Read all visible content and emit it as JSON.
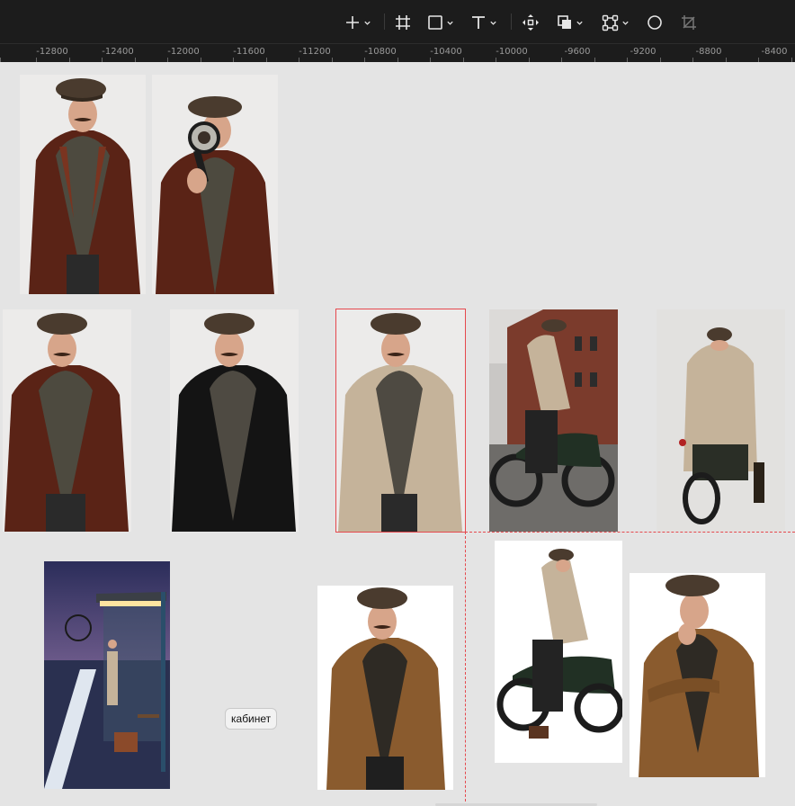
{
  "toolbar": {
    "tools": [
      {
        "name": "add",
        "icon": "plus-icon",
        "has_menu": true
      },
      {
        "name": "frame",
        "icon": "frame-icon",
        "has_menu": false
      },
      {
        "name": "shape",
        "icon": "rectangle-icon",
        "has_menu": true
      },
      {
        "name": "text",
        "icon": "text-icon",
        "has_menu": true
      },
      {
        "name": "move",
        "icon": "move-icon",
        "has_menu": false
      },
      {
        "name": "boolean",
        "icon": "boolean-icon",
        "has_menu": true
      },
      {
        "name": "component",
        "icon": "component-icon",
        "has_menu": true
      },
      {
        "name": "ellipse",
        "icon": "circle-icon",
        "has_menu": false
      },
      {
        "name": "crop",
        "icon": "crop-icon",
        "has_menu": false
      }
    ]
  },
  "ruler": {
    "labels": [
      "-12800",
      "-12400",
      "-12000",
      "-11600",
      "-11200",
      "-10800",
      "-10400",
      "-10000",
      "-9600",
      "-9200",
      "-8800",
      "-8400"
    ]
  },
  "canvas": {
    "sticky_note": "кабинет",
    "images": [
      {
        "id": "leather-coat-1",
        "subject": "man-in-brown-leather-coat"
      },
      {
        "id": "magnifier",
        "subject": "man-with-magnifying-glass"
      },
      {
        "id": "leather-coat-2",
        "subject": "man-in-brown-leather-coat"
      },
      {
        "id": "black-coat",
        "subject": "man-in-black-coat"
      },
      {
        "id": "beige-coat",
        "subject": "man-in-beige-coat",
        "selected": true
      },
      {
        "id": "motorcycle-street",
        "subject": "man-on-motorcycle-street"
      },
      {
        "id": "motorcycle-back",
        "subject": "man-on-motorcycle-back-view"
      },
      {
        "id": "bus-stop",
        "subject": "bus-stop-winter-evening"
      },
      {
        "id": "brown-coat",
        "subject": "man-in-brown-tweed-coat"
      },
      {
        "id": "motorcycle-white",
        "subject": "man-on-motorcycle-white-bg"
      },
      {
        "id": "thinking",
        "subject": "man-in-coat-thinking"
      }
    ]
  },
  "colors": {
    "toolbar_bg": "#1c1c1c",
    "canvas_bg": "#e4e4e4",
    "selection": "#e5484d"
  }
}
